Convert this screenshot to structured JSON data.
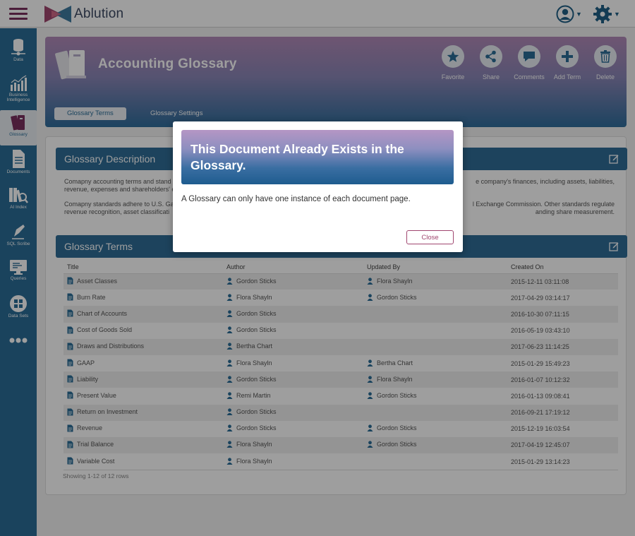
{
  "app": {
    "name": "Ablution",
    "colors": {
      "brand": "#7a2f5e",
      "primary": "#2b6d97",
      "accent": "#a0466f"
    }
  },
  "topbar": {
    "icons": [
      "menu-icon",
      "user-icon",
      "gear-icon"
    ]
  },
  "sidebar": {
    "items": [
      {
        "label": "Data",
        "icon": "database-icon"
      },
      {
        "label": "Business Intelligence",
        "icon": "bar-chart-icon"
      },
      {
        "label": "Glossary",
        "icon": "book-icon"
      },
      {
        "label": "Documents",
        "icon": "document-icon"
      },
      {
        "label": "AI Index",
        "icon": "ai-index-icon"
      },
      {
        "label": "SQL Scribe",
        "icon": "pen-icon"
      },
      {
        "label": "Queries",
        "icon": "monitor-icon"
      },
      {
        "label": "Data Sets",
        "icon": "grid-icon"
      }
    ],
    "active": "Glossary"
  },
  "header": {
    "title": "Accounting Glossary",
    "actions": [
      {
        "label": "Favorite",
        "icon": "star-icon"
      },
      {
        "label": "Share",
        "icon": "share-icon"
      },
      {
        "label": "Comments",
        "icon": "comment-icon"
      },
      {
        "label": "Add Term",
        "icon": "plus-icon"
      },
      {
        "label": "Delete",
        "icon": "trash-icon"
      }
    ],
    "tabs": [
      {
        "label": "Glossary Terms",
        "active": true
      },
      {
        "label": "Glossary Settings",
        "active": false
      }
    ]
  },
  "description": {
    "title": "Glossary Description",
    "para1_left": "Comapny accounting terms and stand",
    "para1_left2": "revenue, expenses and shareholders' e",
    "para1_right": "e company's finances, including assets, liabilities,",
    "para2_left": "Comapny standards adhere to U.S. Ga",
    "para2_left2": "revenue recognition, asset classificati",
    "para2_right": "l Exchange Commission. Other standards regulate",
    "para2_right2": "anding share measurement."
  },
  "terms": {
    "title": "Glossary Terms",
    "columns": [
      "Title",
      "Author",
      "Updated By",
      "Created On"
    ],
    "rows": [
      {
        "title": "Asset Classes",
        "author": "Gordon Sticks",
        "updated_by": "Flora Shayln",
        "created": "2015-12-11 03:11:08"
      },
      {
        "title": "Burn Rate",
        "author": "Flora Shayln",
        "updated_by": "Gordon Sticks",
        "created": "2017-04-29 03:14:17"
      },
      {
        "title": "Chart of Accounts",
        "author": "Gordon Sticks",
        "updated_by": "",
        "created": "2016-10-30 07:11:15"
      },
      {
        "title": "Cost of Goods Sold",
        "author": "Gordon Sticks",
        "updated_by": "",
        "created": "2016-05-19 03:43:10"
      },
      {
        "title": "Draws and Distributions",
        "author": "Bertha Chart",
        "updated_by": "",
        "created": "2017-06-23 11:14:25"
      },
      {
        "title": "GAAP",
        "author": "Flora Shayln",
        "updated_by": "Bertha Chart",
        "created": "2015-01-29 15:49:23"
      },
      {
        "title": "Liability",
        "author": "Gordon Sticks",
        "updated_by": "Flora Shayln",
        "created": "2016-01-07 10:12:32"
      },
      {
        "title": "Present Value",
        "author": "Remi Martin",
        "updated_by": "Gordon Sticks",
        "created": "2016-01-13 09:08:41"
      },
      {
        "title": "Return on Investment",
        "author": "Gordon Sticks",
        "updated_by": "",
        "created": "2016-09-21 17:19:12"
      },
      {
        "title": "Revenue",
        "author": "Gordon Sticks",
        "updated_by": "Gordon Sticks",
        "created": "2015-12-19 16:03:54"
      },
      {
        "title": "Trial Balance",
        "author": "Flora Shayln",
        "updated_by": "Gordon Sticks",
        "created": "2017-04-19 12:45:07"
      },
      {
        "title": "Variable Cost",
        "author": "Flora Shayln",
        "updated_by": "",
        "created": "2015-01-29 13:14:23"
      }
    ],
    "footer": "Showing 1-12 of 12 rows"
  },
  "modal": {
    "title": "This Document Already Exists in the Glossary.",
    "message": "A Glossary can only have one instance of each document page.",
    "close_label": "Close"
  }
}
